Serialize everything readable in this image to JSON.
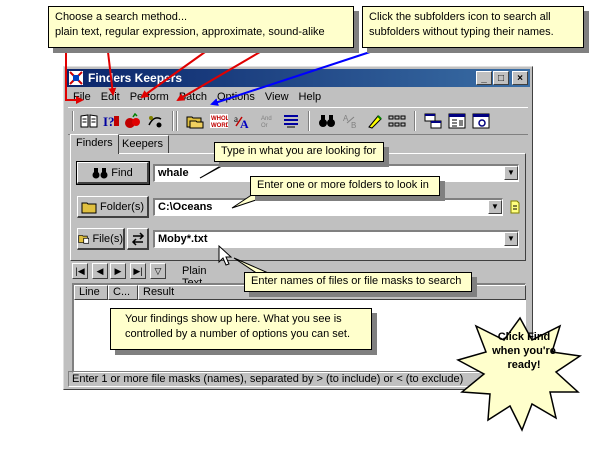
{
  "window": {
    "title": "Finders Keepers"
  },
  "menu": [
    "File",
    "Edit",
    "Perform",
    "Batch",
    "Options",
    "View",
    "Help"
  ],
  "toolbar_icons": [
    "plain-text-search-icon",
    "regex-search-icon",
    "approximate-search-icon",
    "sound-alike-search-icon",
    "subfolders-icon",
    "whole-word-icon",
    "case-sensitive-icon",
    "and-or-not-icon",
    "options-list-icon",
    "find-binoculars-icon",
    "replace-icon",
    "highlight-icon",
    "grid-icon",
    "tile-windows-icon",
    "cascade-icon",
    "preview-icon"
  ],
  "tabs": [
    "Finders",
    "Keepers"
  ],
  "find": {
    "button": "Find",
    "value": "whale"
  },
  "folder": {
    "button": "Folder(s)",
    "value": "C:\\Oceans"
  },
  "files": {
    "button": "File(s)",
    "value": "Moby*.txt"
  },
  "nav": {
    "method_label": "Plain Text Search"
  },
  "results": {
    "columns": [
      "Line",
      "C...",
      "Result"
    ]
  },
  "status": "Enter 1 or more file masks (names), separated by > (to include) or < (to exclude)",
  "callouts": {
    "method": [
      "Choose a search method...",
      "plain text, regular expression, approximate, sound-alike"
    ],
    "subfolders": [
      "Click the subfolders icon to search all",
      "subfolders without typing their names."
    ],
    "type": "Type in what you are looking for",
    "folders": "Enter one or more folders to look in",
    "files": "Enter names of files or file masks to search",
    "findings": [
      "Your findings show up here.  What you see is",
      "controlled by a number of options you can set."
    ],
    "ready": [
      "Click Find",
      "when you're",
      "ready!"
    ]
  },
  "colors": {
    "titlebar": "#0a246a",
    "callout_bg": "#ffffcc",
    "arrow_red": "#e00000",
    "arrow_blue": "#0000ff",
    "burst_fill": "#ffffcc"
  }
}
